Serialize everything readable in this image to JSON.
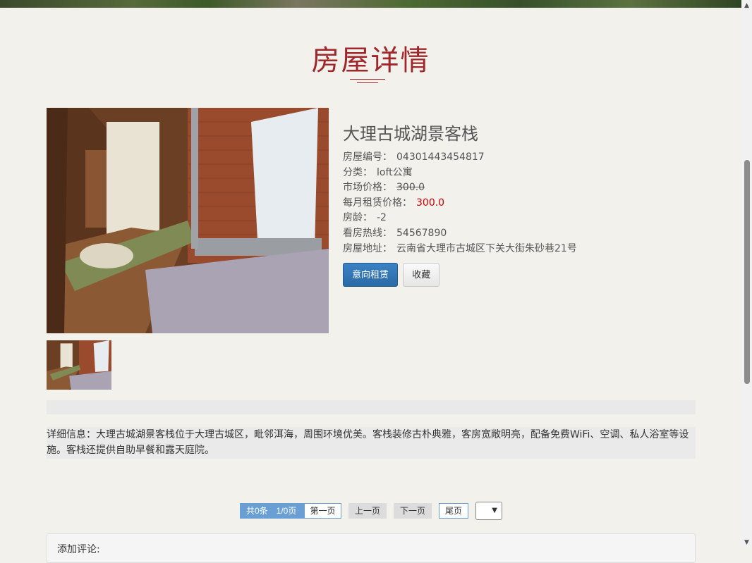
{
  "page": {
    "title": "房屋详情"
  },
  "house": {
    "name": "大理古城湖景客栈",
    "rows": [
      {
        "label": "房屋编号：",
        "value": "04301443454817"
      },
      {
        "label": "分类：",
        "value": "loft公寓"
      },
      {
        "label": "市场价格：",
        "value": "300.0"
      },
      {
        "label": "每月租赁价格：",
        "value": "300.0"
      },
      {
        "label": "房龄：",
        "value": "-2"
      },
      {
        "label": "看房热线：",
        "value": "54567890"
      },
      {
        "label": "房屋地址：",
        "value": "云南省大理市古城区下关大街朱砂巷21号"
      }
    ],
    "buttons": {
      "rent": "意向租赁",
      "favorite": "收藏"
    },
    "detail": "详细信息：大理古城湖景客栈位于大理古城区，毗邻洱海，周围环境优美。客栈装修古朴典雅，客房宽敞明亮，配备免费WiFi、空调、私人浴室等设施。客栈还提供自助早餐和露天庭院。"
  },
  "pager": {
    "info": "共0条　1/0页",
    "first": "第一页",
    "prev": "上一页",
    "next": "下一页",
    "last": "尾页"
  },
  "comment": {
    "label": "添加评论:"
  },
  "colors": {
    "title": "#a1262a",
    "price": "#cc0000",
    "primary": "#2a6aa6",
    "background": "#f2f1ec"
  },
  "icons": {
    "select_chevron": "chevron-down-icon",
    "scroll_up": "scroll-up-arrow-icon",
    "scroll_down": "scroll-down-arrow-icon"
  }
}
